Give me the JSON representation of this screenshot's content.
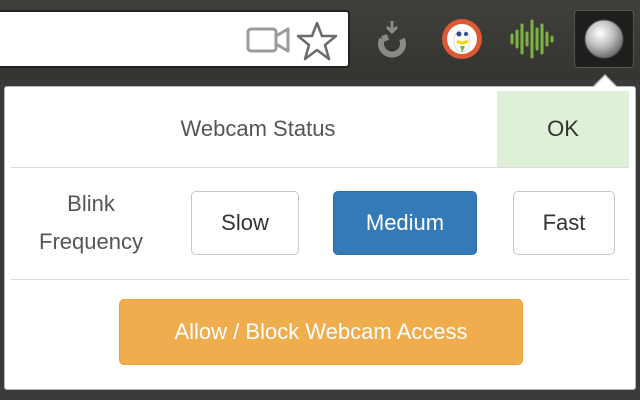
{
  "omnibox": {
    "icons": [
      "video-camera-icon",
      "bookmark-star-icon"
    ]
  },
  "extensions": [
    {
      "name": "recycle-icon"
    },
    {
      "name": "duckduckgo-icon"
    },
    {
      "name": "soundwave-icon"
    },
    {
      "name": "webcam-blinker-icon",
      "active": true
    }
  ],
  "popup": {
    "status_label": "Webcam Status",
    "status_value": "OK",
    "status_color": "#dff0d8",
    "frequency_label": "Blink\nFrequency",
    "frequency_options": [
      "Slow",
      "Medium",
      "Fast"
    ],
    "frequency_selected": "Medium",
    "action_label": "Allow / Block Webcam Access",
    "colors": {
      "primary": "#337ab7",
      "warning": "#f0ad4e"
    }
  }
}
